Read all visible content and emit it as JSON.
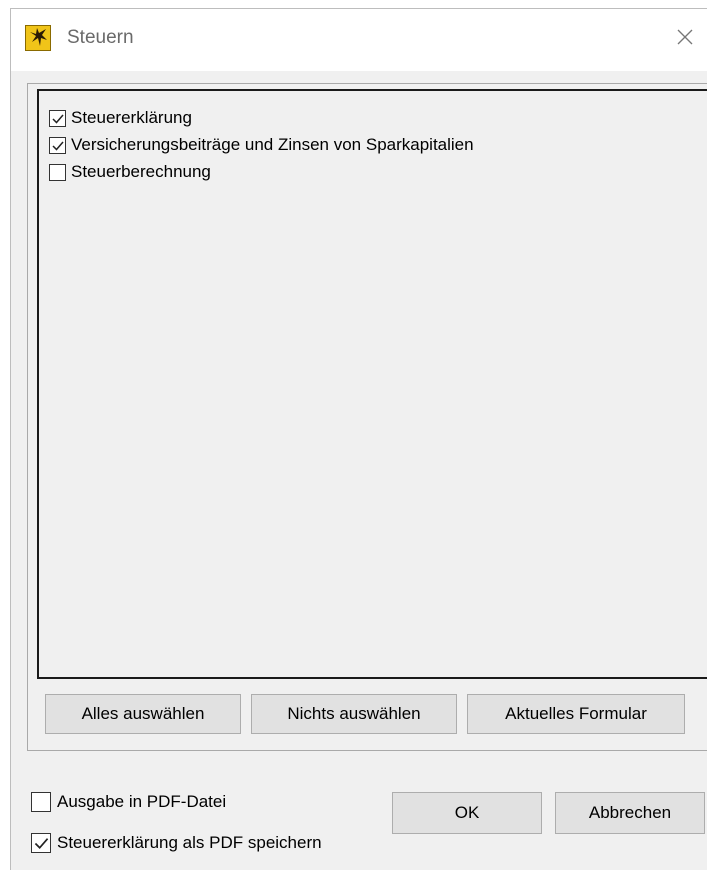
{
  "window": {
    "title": "Steuern",
    "icon": "tax-app-icon",
    "close_icon": "close-icon"
  },
  "list": {
    "items": [
      {
        "label": "Steuererklärung",
        "checked": true
      },
      {
        "label": "Versicherungsbeiträge und Zinsen von Sparkapitalien",
        "checked": true
      },
      {
        "label": "Steuerberechnung",
        "checked": false
      }
    ]
  },
  "buttons": {
    "select_all": "Alles auswählen",
    "select_none": "Nichts auswählen",
    "current_form": "Aktuelles Formular",
    "ok": "OK",
    "cancel": "Abbrechen"
  },
  "options": {
    "pdf_output": {
      "label": "Ausgabe in PDF-Datei",
      "checked": false
    },
    "save_pdf": {
      "label": "Steuererklärung als PDF speichern",
      "checked": true
    }
  }
}
